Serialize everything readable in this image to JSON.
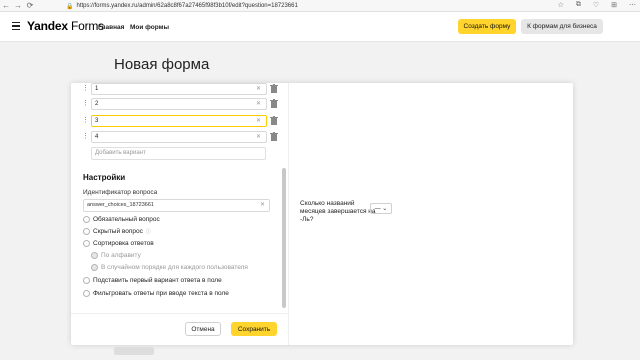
{
  "browser": {
    "back": "←",
    "forward": "→",
    "reload": "⟳",
    "url": "https://forms.yandex.ru/admin/62a8c8f67a27465f98f3b10f/edit?question=18723661",
    "icons": [
      "☆",
      "⧉",
      "♡",
      "⊞",
      "⋯"
    ]
  },
  "header": {
    "brand_main": "Yandex",
    "brand_sub": "Forms",
    "nav": [
      "Главная",
      "Мои формы"
    ],
    "create_button": "Создать форму",
    "business_button": "К формам для бизнеса"
  },
  "page": {
    "title": "Новая форма"
  },
  "editor": {
    "options": [
      "1",
      "2",
      "3",
      "4"
    ],
    "add_option_placeholder": "Добавить вариант",
    "settings_title": "Настройки",
    "id_label": "Идентификатор вопроса",
    "id_value": "answer_choices_18723661",
    "checks": [
      "Обязательный вопрос",
      "Скрытый вопрос",
      "Сортировка ответов",
      "По алфавиту",
      "В случайном порядке для каждого пользователя",
      "Подставить первый вариант ответа в поле",
      "Фильтровать ответы при вводе текста в поле"
    ],
    "cancel": "Отмена",
    "save": "Сохранить"
  },
  "preview": {
    "question": "Сколько названий месяцев завершается на -Ль?",
    "select_value": "— ⌄"
  },
  "colors": {
    "accent": "#ffd42d"
  }
}
